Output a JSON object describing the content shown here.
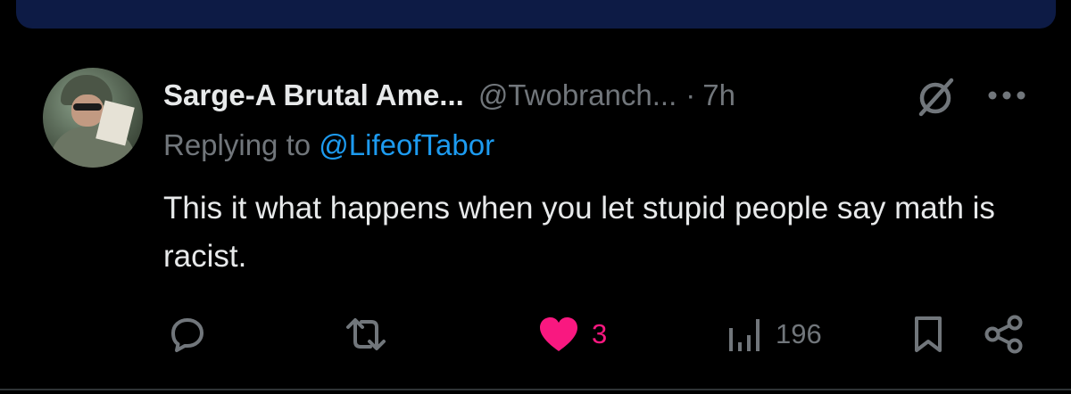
{
  "tweet": {
    "author": {
      "display_name": "Sarge-A Brutal Ame...",
      "handle": "@Twobranch...",
      "separator": "·",
      "time": "7h"
    },
    "replying_to": {
      "prefix": "Replying to",
      "handle": "@LifeofTabor"
    },
    "text": "This it what happens when you let stupid people say math is racist.",
    "actions": {
      "like_count": "3",
      "views_count": "196"
    }
  },
  "colors": {
    "background": "#000000",
    "banner": "#0d1b45",
    "text_primary": "#e7e9ea",
    "text_secondary": "#71767b",
    "link": "#1d9bf0",
    "like": "#f91880"
  },
  "icons": [
    "avatar",
    "grok-icon",
    "more-icon",
    "reply-icon",
    "retweet-icon",
    "like-icon",
    "views-icon",
    "bookmark-icon",
    "share-icon"
  ]
}
